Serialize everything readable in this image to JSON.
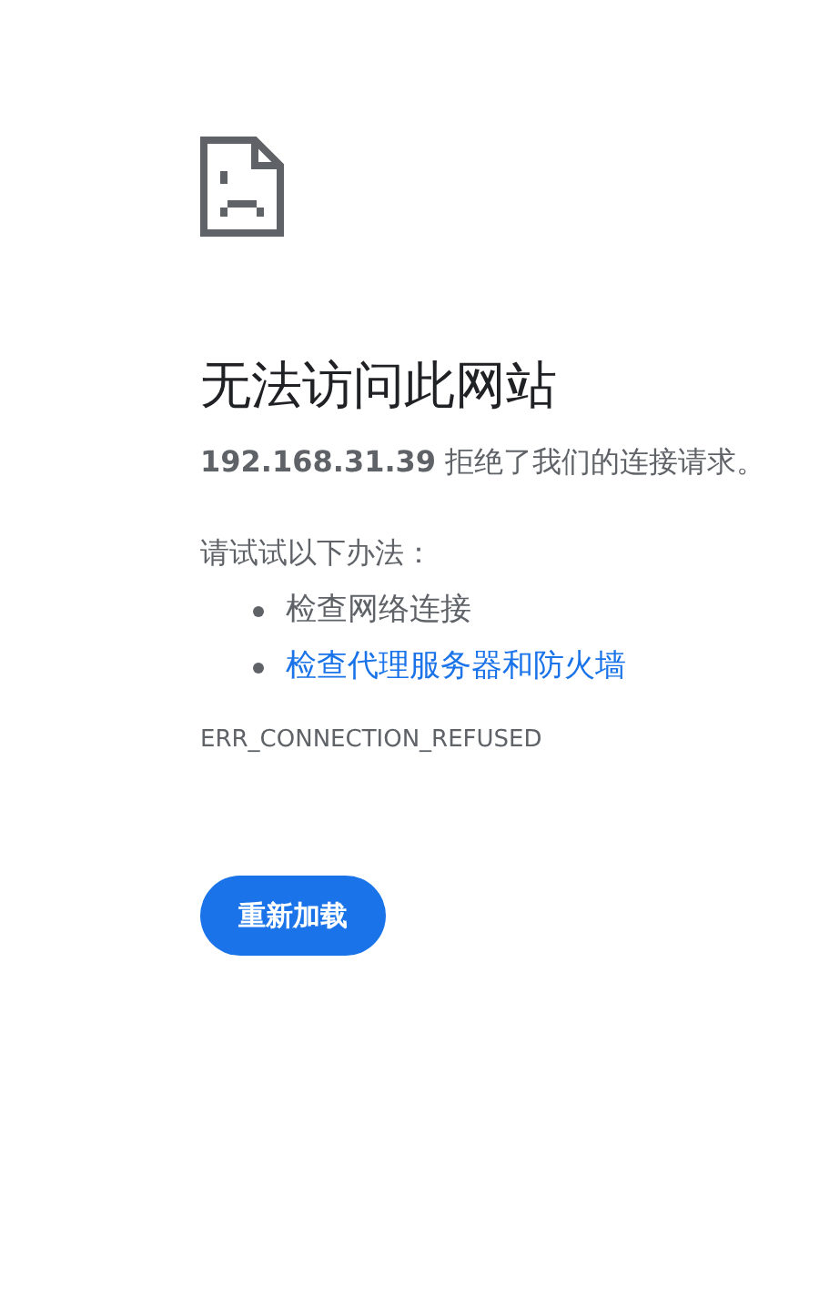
{
  "title": "无法访问此网站",
  "message": "**192.168.31.39** 拒绝了我们的连接请求。",
  "suggestions": {
    "heading": "请试试以下办法：",
    "items": [
      {
        "kind": "text",
        "label": "检查网络连接"
      },
      {
        "kind": "link",
        "label": "检查代理服务器和防火墙"
      }
    ]
  },
  "error_code": "ERR_CONNECTION_REFUSED",
  "buttons": [
    "重新加载"
  ]
}
